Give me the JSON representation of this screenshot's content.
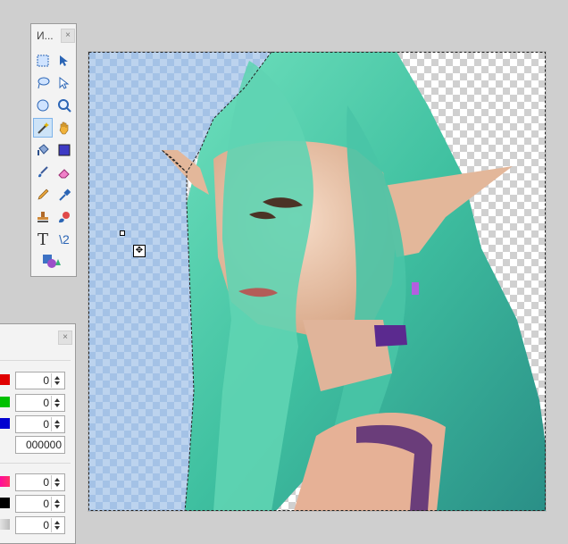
{
  "tools_window": {
    "title": "И...",
    "close_label": "×",
    "tools": [
      {
        "name": "rectangle-select-tool-icon",
        "label": "Rectangle Select"
      },
      {
        "name": "move-selected-pixels-tool-icon",
        "label": "Move Selected Pixels"
      },
      {
        "name": "lasso-select-tool-icon",
        "label": "Lasso Select"
      },
      {
        "name": "move-selection-tool-icon",
        "label": "Move Selection"
      },
      {
        "name": "ellipse-select-tool-icon",
        "label": "Ellipse Select"
      },
      {
        "name": "zoom-tool-icon",
        "label": "Zoom"
      },
      {
        "name": "magic-wand-tool-icon",
        "label": "Magic Wand"
      },
      {
        "name": "pan-tool-icon",
        "label": "Pan"
      },
      {
        "name": "paint-bucket-tool-icon",
        "label": "Paint Bucket"
      },
      {
        "name": "gradient-tool-icon",
        "label": "Gradient"
      },
      {
        "name": "paintbrush-tool-icon",
        "label": "Paintbrush"
      },
      {
        "name": "eraser-tool-icon",
        "label": "Eraser"
      },
      {
        "name": "pencil-tool-icon",
        "label": "Pencil"
      },
      {
        "name": "color-picker-tool-icon",
        "label": "Color Picker"
      },
      {
        "name": "clone-stamp-tool-icon",
        "label": "Clone Stamp"
      },
      {
        "name": "recolor-tool-icon",
        "label": "Recolor"
      },
      {
        "name": "text-tool-icon",
        "label": "Text",
        "glyph": "T"
      },
      {
        "name": "line-curve-tool-icon",
        "label": "Line / Curve",
        "glyph": "\\2"
      },
      {
        "name": "shapes-tool-icon",
        "label": "Shapes"
      }
    ],
    "active_tool": "magic-wand-tool-icon"
  },
  "colors_window": {
    "close_label": "×",
    "rgb": {
      "red": "0",
      "green": "0",
      "blue": "0"
    },
    "hex": "000000",
    "hsv": {
      "hue": "0",
      "saturation": "0",
      "value": "0"
    }
  },
  "colors": {
    "red": "#e00000",
    "green": "#00c000",
    "blue": "#0000d0",
    "hue": "#ff00aa",
    "value": "#000000",
    "selection_tint": "#8fb9e6"
  }
}
